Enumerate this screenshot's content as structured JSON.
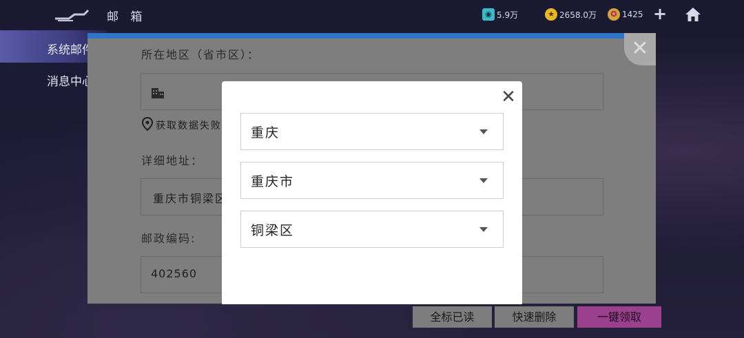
{
  "header": {
    "title": "邮 箱",
    "resources": [
      {
        "icon": "gem-icon",
        "value": "5.9万",
        "color": "#3fb8c8"
      },
      {
        "icon": "star-coin-icon",
        "value": "2658.0万",
        "color": "#e7b72a"
      },
      {
        "icon": "star-token-icon",
        "value": "1425",
        "color": "#d3a43b"
      }
    ]
  },
  "sidebar": {
    "items": [
      {
        "label": "系统邮件"
      },
      {
        "label": "消息中心"
      }
    ]
  },
  "address_form": {
    "region_label": "所在地区（省市区）：",
    "location_status": "获取数据失败",
    "detail_label": "详细地址：",
    "detail_value": "重庆市铜梁区",
    "postal_label": "邮政编码:",
    "postal_value": "402560"
  },
  "bottom_actions": {
    "mark_read": "全标已读",
    "quick_delete": "快速删除",
    "claim_all": "一键领取"
  },
  "region_picker": {
    "province": "重庆",
    "city": "重庆市",
    "district": "铜梁区",
    "close_symbol": "✕"
  },
  "colors": {
    "accent_blue": "#2f76c9",
    "claim_button": "#9b3f8f",
    "panel_dim": "#7e7e7e"
  }
}
